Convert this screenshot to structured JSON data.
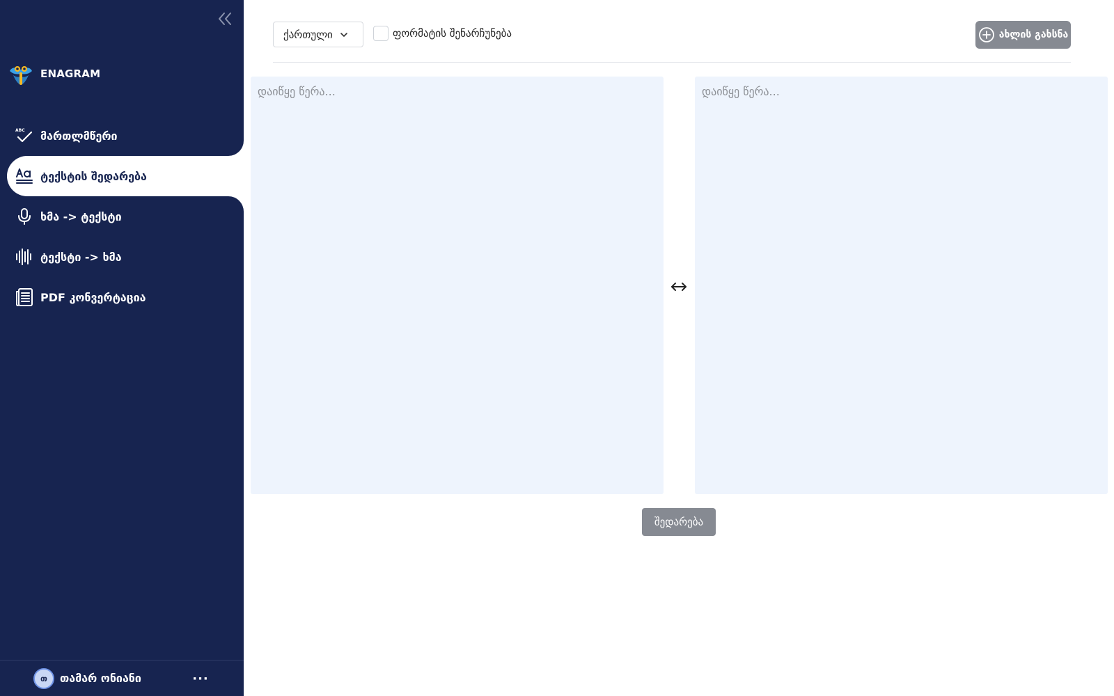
{
  "app": {
    "brand_name": "ENAGRAM"
  },
  "sidebar": {
    "items": [
      {
        "label": "მართლმწერი",
        "icon": "spellcheck-icon"
      },
      {
        "label": "ტექსტის შედარება",
        "icon": "text-compare-icon",
        "active": true
      },
      {
        "label": "ხმა -> ტექსტი",
        "icon": "microphone-icon"
      },
      {
        "label": "ტექსტი -> ხმა",
        "icon": "soundwave-icon"
      },
      {
        "label": "PDF კონვერტაცია",
        "icon": "document-icon"
      }
    ],
    "user": {
      "initial": "თ",
      "name": "თამარ ონიანი"
    },
    "more_label": "···"
  },
  "toolbar": {
    "language": "ქართული",
    "format_label": "ფორმატის შენარჩუნება",
    "format_checked": false,
    "new_label": "ახლის გახსნა"
  },
  "editor": {
    "left_placeholder": "დაიწყე წერა...",
    "right_placeholder": "დაიწყე წერა...",
    "compare_label": "შედარება"
  },
  "colors": {
    "sidebar_bg": "#172450",
    "panel_bg": "#eef4fd",
    "button_gray": "#868a92"
  }
}
